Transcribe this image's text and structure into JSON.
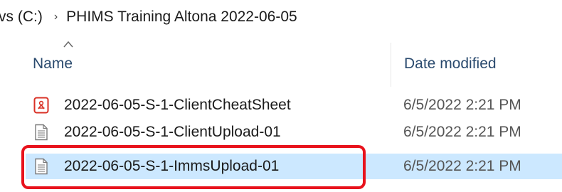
{
  "breadcrumb": {
    "drive": "vs (C:)",
    "separator": "›",
    "folder": "PHIMS Training Altona 2022-06-05"
  },
  "columns": {
    "name": "Name",
    "date_modified": "Date modified",
    "sort_icon": "chevron-up-icon"
  },
  "files": [
    {
      "name": "2022-06-05-S-1-ClientCheatSheet",
      "date": "6/5/2022 2:21 PM",
      "icon": "pdf-icon",
      "selected": false
    },
    {
      "name": "2022-06-05-S-1-ClientUpload-01",
      "date": "6/5/2022 2:21 PM",
      "icon": "text-file-icon",
      "selected": false
    },
    {
      "name": "2022-06-05-S-1-ImmsUpload-01",
      "date": "6/5/2022 2:21 PM",
      "icon": "text-file-icon",
      "selected": true
    }
  ],
  "colors": {
    "selection": "#cce8ff",
    "highlight_border": "#e8121c",
    "pdf_icon": "#d93025"
  }
}
